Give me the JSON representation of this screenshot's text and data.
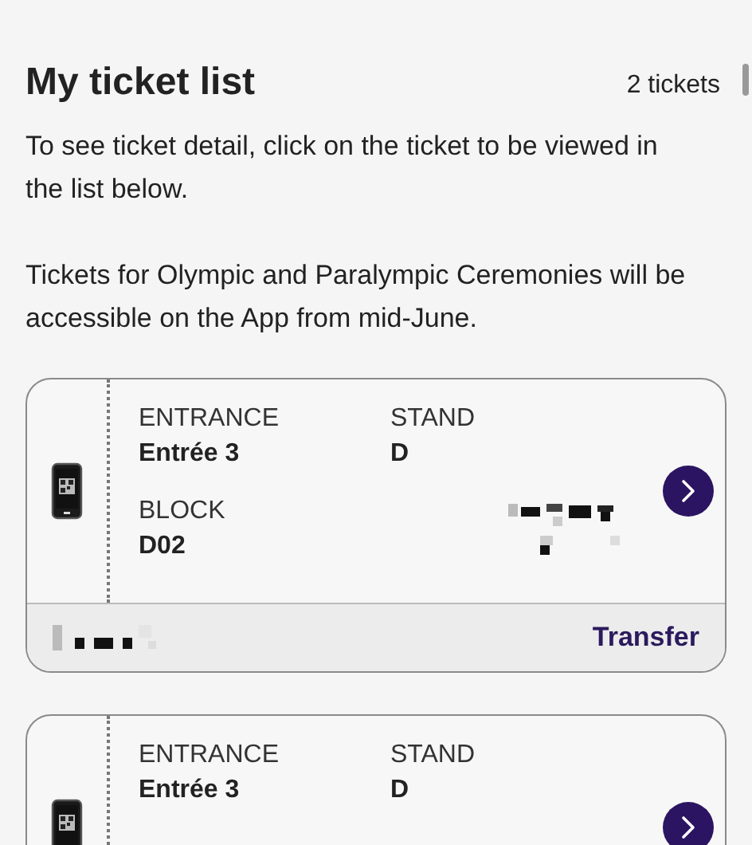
{
  "header": {
    "title": "My ticket list",
    "count": "2 tickets"
  },
  "paragraphs": [
    "To see ticket detail, click on the ticket to be viewed in the list below.",
    "Tickets for Olympic and Paralympic Ceremonies will be accessible on the App from mid-June."
  ],
  "tickets": [
    {
      "fields": [
        {
          "kind": "text",
          "label": "ENTRANCE",
          "value": "Entrée 3"
        },
        {
          "kind": "text",
          "label": "STAND",
          "value": "D"
        },
        {
          "kind": "text",
          "label": "BLOCK",
          "value": "D02"
        },
        {
          "kind": "redacted"
        }
      ],
      "footer": {
        "holder_redacted": true,
        "action": "Transfer"
      }
    },
    {
      "fields": [
        {
          "kind": "text",
          "label": "ENTRANCE",
          "value": "Entrée 3"
        },
        {
          "kind": "text",
          "label": "STAND",
          "value": "D"
        }
      ]
    }
  ]
}
